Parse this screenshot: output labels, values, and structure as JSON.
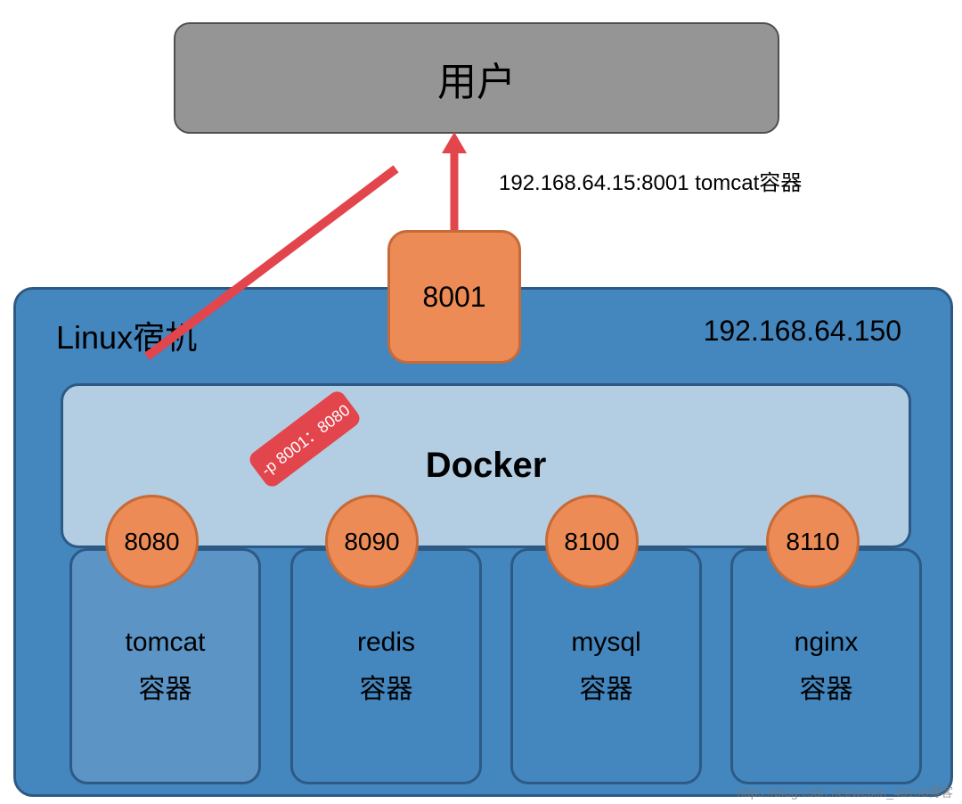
{
  "user_box": "用户",
  "arrow_label": "192.168.64.15:8001 tomcat容器",
  "port_8001": "8001",
  "linux_label": "Linux宿机",
  "host_ip": "192.168.64.150",
  "docker_label": "Docker",
  "mapping_label": "-p 8001：8080",
  "containers": [
    {
      "port": "8080",
      "name": "tomcat",
      "sub": "容器"
    },
    {
      "port": "8090",
      "name": "redis",
      "sub": "容器"
    },
    {
      "port": "8100",
      "name": "mysql",
      "sub": "容器"
    },
    {
      "port": "8110",
      "name": "nginx",
      "sub": "容器"
    }
  ],
  "watermark": "https://blog.csdn.net/weixin_45103博客",
  "colors": {
    "orange": "#EC8B56",
    "orange_border": "#C66A38",
    "blue": "#4486BE",
    "blue_light": "#B3CDE3",
    "blue_border": "#2D5A85",
    "red": "#E2454C",
    "gray": "#959595"
  }
}
